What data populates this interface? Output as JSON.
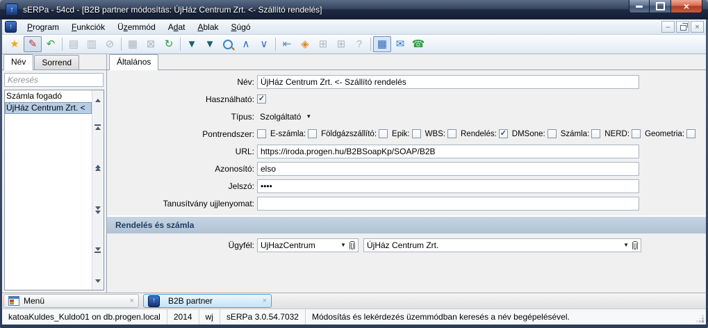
{
  "window": {
    "title": "sERPa - 54cd - [B2B partner módosítás: ÚjHáz Centrum Zrt. <- Szállító rendelés]"
  },
  "icons": {
    "close": "×",
    "minimize": "–",
    "check": "✓",
    "combo_arrow": "▼",
    "logo_arrow": "↑"
  },
  "menubar": {
    "items": [
      {
        "name": "program",
        "label": "Program",
        "underline": 0
      },
      {
        "name": "funkciok",
        "label": "Funkciók",
        "underline": 0
      },
      {
        "name": "uzemmod",
        "label": "Üzemmód",
        "underline": 1
      },
      {
        "name": "adat",
        "label": "Adat",
        "underline": 1
      },
      {
        "name": "ablak",
        "label": "Ablak",
        "underline": 0
      },
      {
        "name": "sugo",
        "label": "Súgó",
        "underline": 0
      }
    ]
  },
  "toolbar": {
    "buttons": [
      {
        "name": "new-icon",
        "glyph": "★",
        "color": "#f0a81c",
        "enabled": true
      },
      {
        "name": "edit-icon",
        "glyph": "✎",
        "color": "#b33a2e",
        "enabled": true,
        "pressed": true
      },
      {
        "name": "undo-icon",
        "glyph": "↶",
        "color": "#2f9e41",
        "enabled": true,
        "sep": true
      },
      {
        "name": "print-icon",
        "glyph": "▤",
        "color": "#b0b6be",
        "enabled": false
      },
      {
        "name": "journal-icon",
        "glyph": "▥",
        "color": "#b0b6be",
        "enabled": false
      },
      {
        "name": "attachment-icon",
        "glyph": "⊘",
        "color": "#b0b6be",
        "enabled": false,
        "sep": true
      },
      {
        "name": "save-icon",
        "glyph": "▦",
        "color": "#b0b6be",
        "enabled": false
      },
      {
        "name": "cancel-save-icon",
        "glyph": "⊠",
        "color": "#b0b6be",
        "enabled": false
      },
      {
        "name": "refresh-icon",
        "glyph": "↻",
        "color": "#2f9e41",
        "enabled": true,
        "sep": true
      },
      {
        "name": "filter-icon",
        "glyph": "▼",
        "color": "#1d5f6e",
        "enabled": true
      },
      {
        "name": "filter-form-icon",
        "glyph": "▼",
        "color": "#1d5f6e",
        "enabled": true
      },
      {
        "name": "search-icon",
        "css": "tb-zoom",
        "enabled": true
      },
      {
        "name": "chevron-up-icon",
        "glyph": "∧",
        "color": "#2e6dbd",
        "enabled": true
      },
      {
        "name": "chevron-down-icon",
        "glyph": "∨",
        "color": "#2e6dbd",
        "enabled": true,
        "sep": true
      },
      {
        "name": "navigate-back-icon",
        "glyph": "⇤",
        "color": "#5a87b8",
        "enabled": true
      },
      {
        "name": "compose-icon",
        "glyph": "◈",
        "color": "#e8821e",
        "enabled": true
      },
      {
        "name": "prev-window-icon",
        "glyph": "⊞",
        "color": "#b0b6be",
        "enabled": false
      },
      {
        "name": "next-window-icon",
        "glyph": "⊞",
        "color": "#b0b6be",
        "enabled": false
      },
      {
        "name": "help-icon",
        "glyph": "?",
        "color": "#b0b6be",
        "enabled": false,
        "sep": true
      },
      {
        "name": "calculator-icon",
        "glyph": "▦",
        "color": "#3668b8",
        "enabled": true,
        "active": true
      },
      {
        "name": "email-icon",
        "glyph": "✉",
        "color": "#2e7ad1",
        "enabled": true
      },
      {
        "name": "phone-icon",
        "glyph": "☎",
        "color": "#2f9e41",
        "enabled": true
      }
    ]
  },
  "left_panel": {
    "tabs": [
      {
        "label": "Név"
      },
      {
        "label": "Sorrend"
      }
    ],
    "search_placeholder": "Keresés",
    "list": {
      "items": [
        "Számla fogadó",
        "ÚjHáz Centrum Zrt. <"
      ],
      "selected_index": 1
    }
  },
  "main": {
    "tab": "Általános",
    "fields": {
      "nev": {
        "label": "Név:",
        "value": "ÚjHáz Centrum Zrt. <- Szállító rendelés"
      },
      "hasznalhato": {
        "label": "Használható:",
        "checked": true
      },
      "tipus": {
        "label": "Típus:",
        "value": "Szolgáltató"
      },
      "pontrendszer": {
        "items": [
          {
            "label": "Pontrendszer:",
            "checked": false
          },
          {
            "label": "E-számla:",
            "checked": false
          },
          {
            "label": "Földgázszállító:",
            "checked": false
          },
          {
            "label": "Epik:",
            "checked": false
          },
          {
            "label": "WBS:",
            "checked": false
          },
          {
            "label": "Rendelés:",
            "checked": true
          },
          {
            "label": "DMSone:",
            "checked": false
          },
          {
            "label": "Számla:",
            "checked": false
          },
          {
            "label": "NERD:",
            "checked": false
          },
          {
            "label": "Geometria:",
            "checked": false
          }
        ]
      },
      "url": {
        "label": "URL:",
        "value": "https://iroda.progen.hu/B2BSoapKp/SOAP/B2B"
      },
      "azonosito": {
        "label": "Azonosító:",
        "value": "elso"
      },
      "jelszo": {
        "label": "Jelszó:",
        "value": "••••"
      },
      "tanusitvany": {
        "label": "Tanusítvány ujjlenyomat:",
        "value": ""
      }
    },
    "section_title": "Rendelés és számla",
    "ugyfel": {
      "label": "Ügyfél:",
      "combo1": "UjHazCentrum",
      "combo2": "ÚjHáz Centrum Zrt."
    }
  },
  "bottom_tabs": [
    {
      "label": "Menü"
    },
    {
      "label": "B2B partner",
      "active": true
    }
  ],
  "statusbar": {
    "items": [
      "katoaKuldes_Kuldo01 on db.progen.local",
      "2014",
      "wj",
      "sERPa 3.0.54.7032",
      "Módosítás és lekérdezés üzemmódban keresés a név begépelésével."
    ]
  }
}
